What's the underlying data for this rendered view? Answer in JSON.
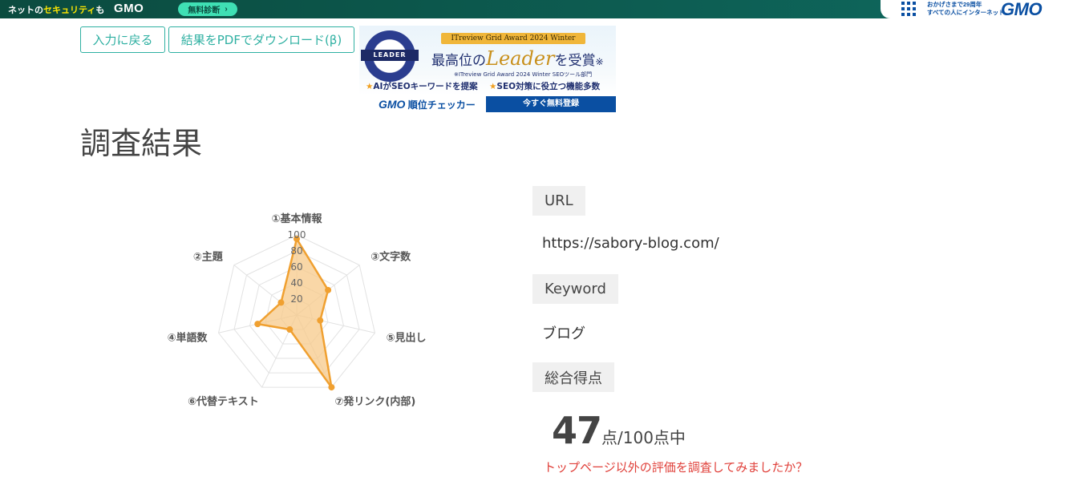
{
  "topbar": {
    "slogan_pre": "ネットの",
    "slogan_accent": "セキュリティ",
    "slogan_post": "も",
    "logo_left": "GMO",
    "diag_button": "無料診断",
    "tagline_line1": "おかげさまで29周年",
    "tagline_line2": "すべての人にインターネット",
    "logo_right": "GMO"
  },
  "toolbar": {
    "back_label": "入力に戻る",
    "pdf_label": "結果をPDFでダウンロード(β)"
  },
  "banner": {
    "badge_text": "LEADER",
    "award": "ITreview Grid Award 2024 Winter",
    "headline_pre": "最高位の",
    "headline_big": "Leader",
    "headline_post": "を受賞",
    "headline_mark": "※",
    "note": "※ITreview Grid Award 2024 Winter SEOツール部門",
    "feature1": "AIがSEOキーワードを提案",
    "feature2": "SEO対策に役立つ機能多数",
    "brand_gmo": "GMO",
    "brand_name": "順位チェッカー",
    "cta": "今すぐ無料登録"
  },
  "page": {
    "title": "調査結果"
  },
  "chart_data": {
    "type": "radar",
    "categories": [
      "①基本情報",
      "③文字数",
      "⑤見出し",
      "⑦発リンク(内部)",
      "⑥代替テキスト",
      "④単語数",
      "②主題"
    ],
    "values": [
      95,
      50,
      30,
      100,
      20,
      50,
      25
    ],
    "ticks": [
      "20",
      "40",
      "60",
      "80",
      "100"
    ],
    "rlim": [
      0,
      100
    ],
    "series_color": "#f0a030",
    "fill_color": "#f7c98a"
  },
  "info": {
    "url_label": "URL",
    "url_value": "https://sabory-blog.com/",
    "keyword_label": "Keyword",
    "keyword_value": "ブログ",
    "score_label": "総合得点",
    "score_value": "47",
    "score_suffix": "点/100点中",
    "promo": "トップページ以外の評価を調査してみましたか？"
  }
}
